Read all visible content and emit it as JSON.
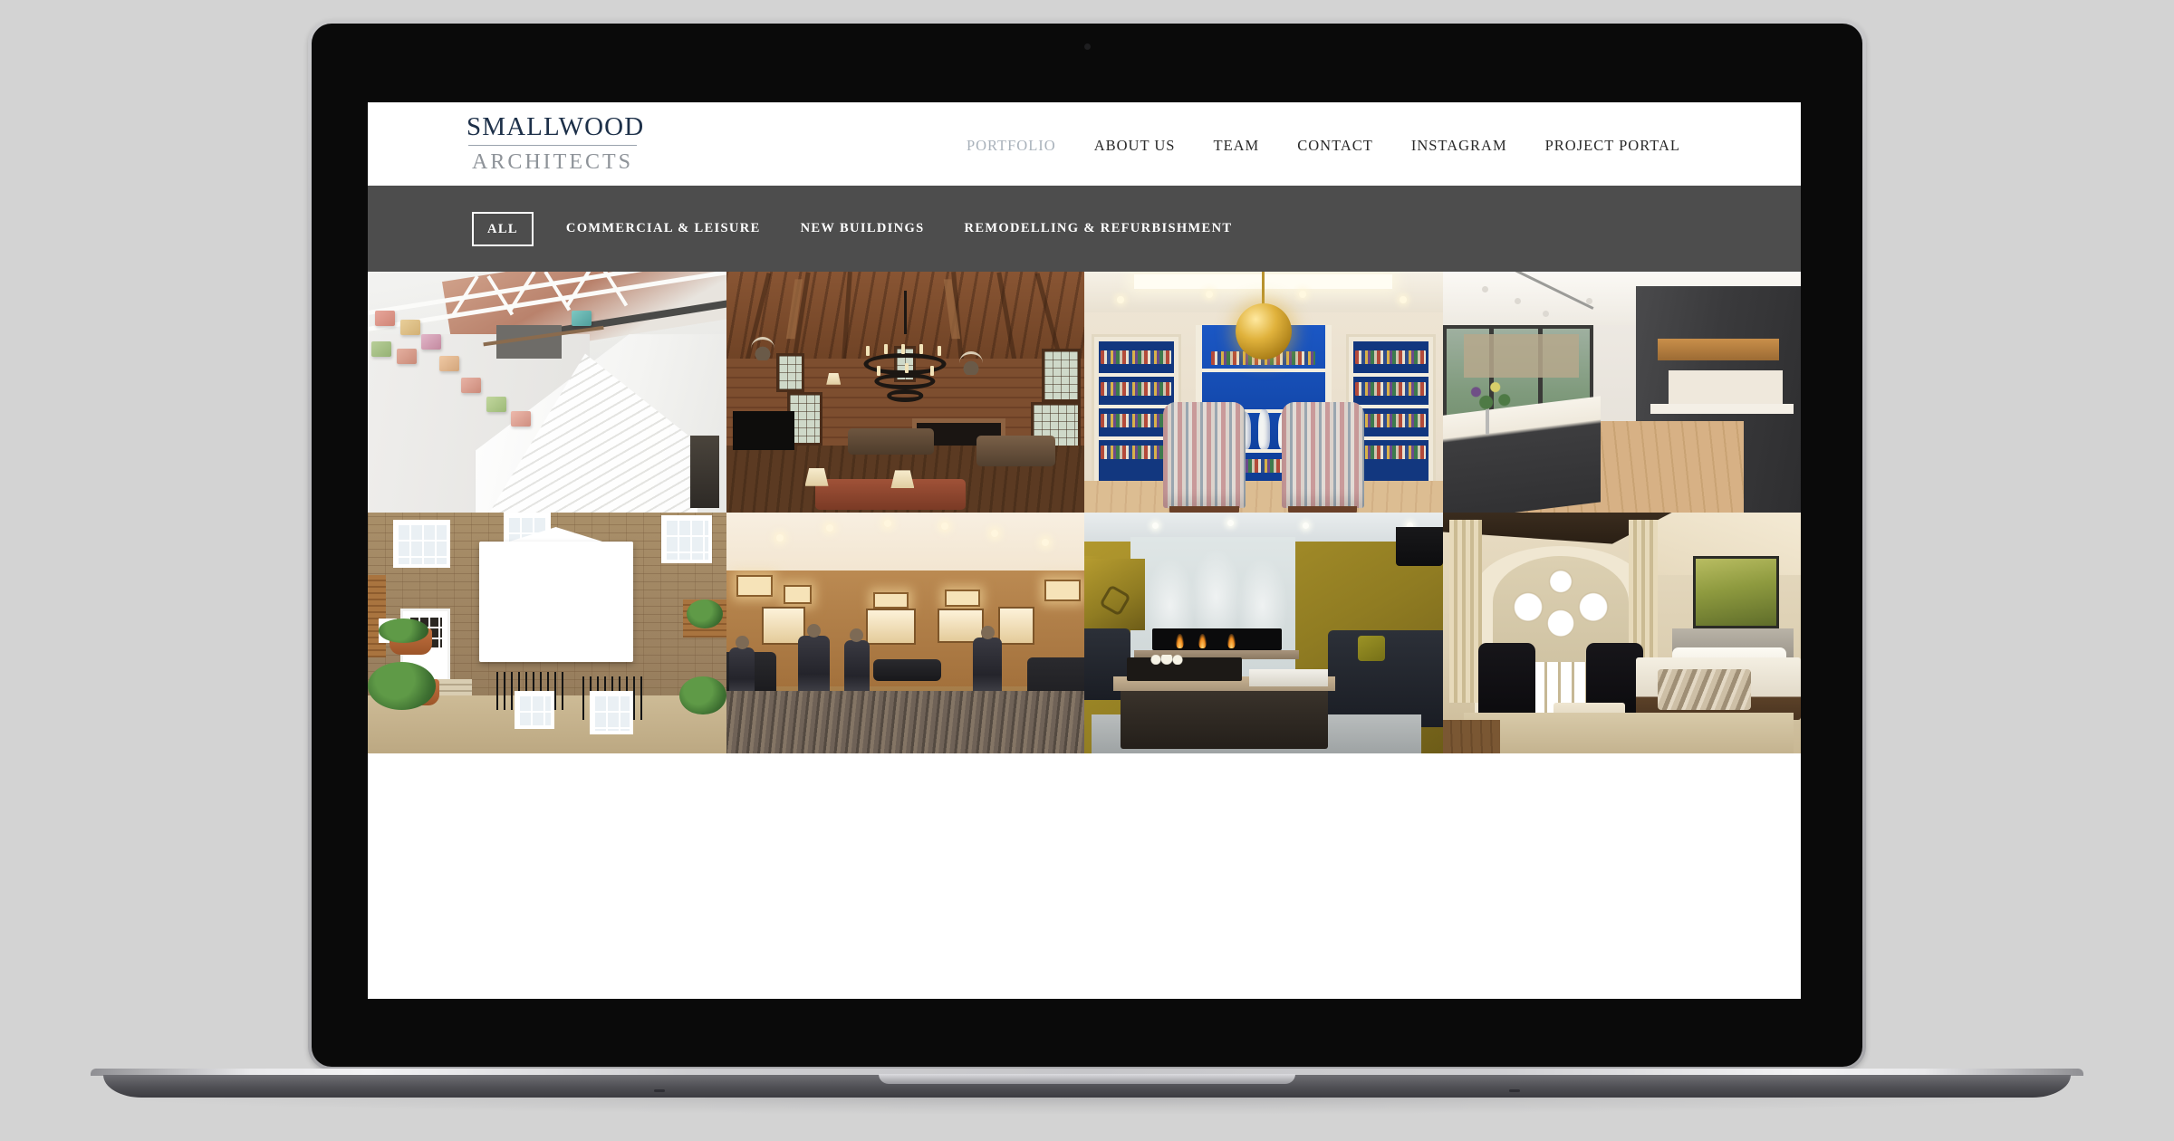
{
  "site": {
    "logo": {
      "line1": "SMALLWOOD",
      "line2": "ARCHITECTS"
    },
    "nav": [
      {
        "label": "PORTFOLIO",
        "active": true
      },
      {
        "label": "ABOUT US",
        "active": false
      },
      {
        "label": "TEAM",
        "active": false
      },
      {
        "label": "CONTACT",
        "active": false
      },
      {
        "label": "INSTAGRAM",
        "active": false
      },
      {
        "label": "PROJECT PORTAL",
        "active": false
      }
    ],
    "filters": [
      {
        "label": "ALL",
        "active": true
      },
      {
        "label": "COMMERCIAL & LEISURE",
        "active": false
      },
      {
        "label": "NEW BUILDINGS",
        "active": false
      },
      {
        "label": "REMODELLING & REFURBISHMENT",
        "active": false
      }
    ],
    "gallery": [
      {
        "name": "white-gallery-staircase",
        "alt": "White double-height gallery interior with open staircase, roof skylight trusses and colourful block artworks mounted on the wall"
      },
      {
        "name": "timber-lodge-great-room",
        "alt": "Rustic timber lodge great room with exposed roof trusses, large wrought-iron candle chandelier, mounted antlers and leather sofas"
      },
      {
        "name": "blue-library-reading-room",
        "alt": "Library with cream joinery and blue-painted bookcases, gold globe pendant light and two striped wing-back armchairs"
      },
      {
        "name": "dark-modern-kitchen",
        "alt": "Contemporary kitchen extension with dark grey handleless cabinetry, marble island, oak floor and sliding glass doors to a garden"
      },
      {
        "name": "brick-townhouse-rear-extension",
        "alt": "Rear elevation of a stock-brick townhouse with a white pedimented bay window extension, stone steps and planted courtyard garden"
      },
      {
        "name": "luxury-retail-store",
        "alt": "Luxury retail shop interior with warm wood panelling, illuminated display niches, central round table and striped carpet"
      },
      {
        "name": "modern-fireplace-lounge",
        "alt": "Contemporary living room with a long linear gas fireplace, dark sofas, large upholstered ottoman table and gold artwork"
      },
      {
        "name": "gothic-window-bedroom",
        "alt": "Luxury bedroom with a Gothic traceried window, full-height curtains, black wing chairs, fur throw on the bed and a green landscape painting"
      }
    ]
  },
  "colors": {
    "logo_primary": "#1d3049",
    "logo_secondary": "#8e9399",
    "nav_text": "#2a2a2a",
    "nav_active": "#a9b2bb",
    "filter_bar_bg": "#4d4d4d",
    "filter_text": "#ffffff",
    "page_bg": "#d3d3d3",
    "bezel": "#0a0a0a"
  }
}
